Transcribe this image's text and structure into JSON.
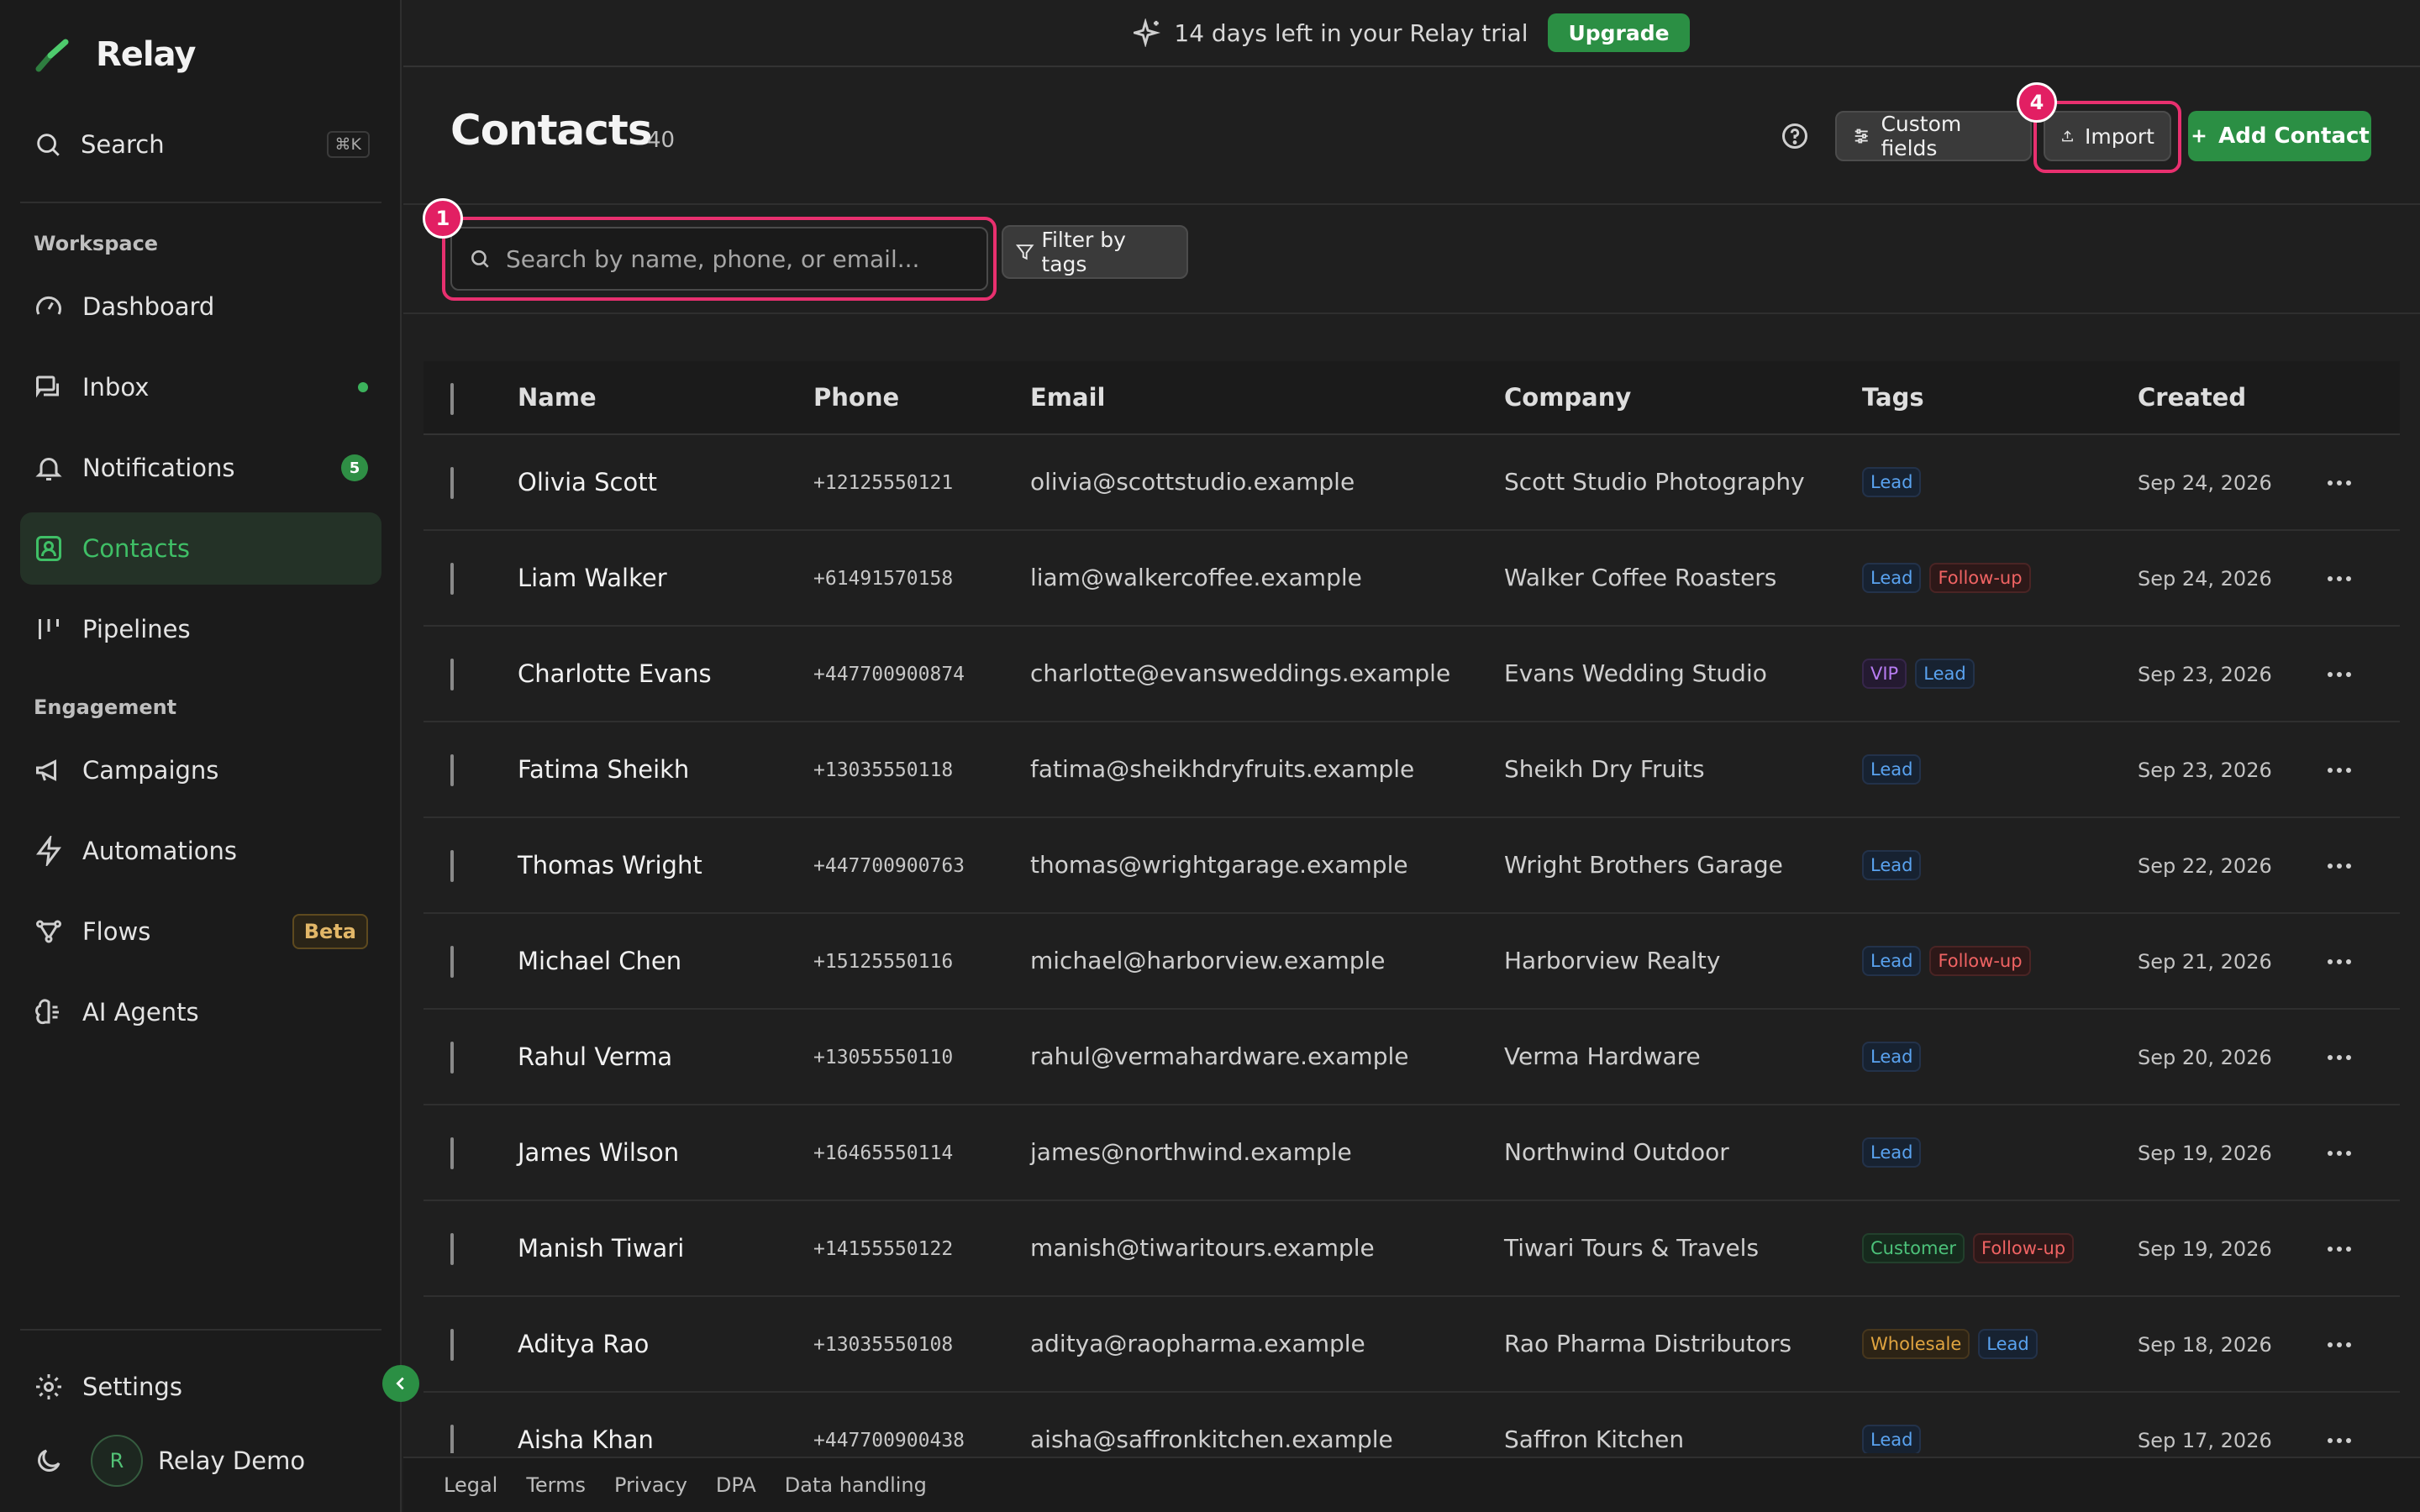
{
  "app": {
    "name": "Relay"
  },
  "sidebar": {
    "search_label": "Search",
    "search_shortcut": "⌘K",
    "sections": {
      "workspace": "Workspace",
      "engagement": "Engagement"
    },
    "items": [
      {
        "label": "Dashboard",
        "icon": "gauge-icon"
      },
      {
        "label": "Inbox",
        "icon": "inbox-icon",
        "dot": true
      },
      {
        "label": "Notifications",
        "icon": "bell-icon",
        "badge": "5"
      },
      {
        "label": "Contacts",
        "icon": "contacts-icon",
        "active": true
      },
      {
        "label": "Pipelines",
        "icon": "pipeline-icon"
      },
      {
        "label": "Campaigns",
        "icon": "megaphone-icon"
      },
      {
        "label": "Automations",
        "icon": "bolt-icon"
      },
      {
        "label": "Flows",
        "icon": "flow-icon",
        "badge": "Beta"
      },
      {
        "label": "AI Agents",
        "icon": "brain-icon"
      }
    ],
    "settings_label": "Settings",
    "user": {
      "initial": "R",
      "name": "Relay Demo"
    }
  },
  "banner": {
    "text": "14 days left in your Relay trial",
    "button": "Upgrade"
  },
  "header": {
    "title": "Contacts",
    "count": "40",
    "custom_fields": "Custom fields",
    "import": "Import",
    "add_contact": "Add Contact",
    "import_marker": "4"
  },
  "search": {
    "placeholder": "Search by name, phone, or email...",
    "value": "",
    "marker": "1",
    "filter_label": "Filter by tags"
  },
  "table": {
    "columns": [
      "Name",
      "Phone",
      "Email",
      "Company",
      "Tags",
      "Created"
    ],
    "rows": [
      {
        "name": "Olivia Scott",
        "phone": "+12125550121",
        "email": "olivia@scottstudio.example",
        "company": "Scott Studio Photography",
        "tags": [
          "Lead"
        ],
        "created": "Sep 24, 2026"
      },
      {
        "name": "Liam Walker",
        "phone": "+61491570158",
        "email": "liam@walkercoffee.example",
        "company": "Walker Coffee Roasters",
        "tags": [
          "Lead",
          "Follow-up"
        ],
        "created": "Sep 24, 2026"
      },
      {
        "name": "Charlotte Evans",
        "phone": "+447700900874",
        "email": "charlotte@evansweddings.example",
        "company": "Evans Wedding Studio",
        "tags": [
          "VIP",
          "Lead"
        ],
        "created": "Sep 23, 2026"
      },
      {
        "name": "Fatima Sheikh",
        "phone": "+13035550118",
        "email": "fatima@sheikhdryfruits.example",
        "company": "Sheikh Dry Fruits",
        "tags": [
          "Lead"
        ],
        "created": "Sep 23, 2026"
      },
      {
        "name": "Thomas Wright",
        "phone": "+447700900763",
        "email": "thomas@wrightgarage.example",
        "company": "Wright Brothers Garage",
        "tags": [
          "Lead"
        ],
        "created": "Sep 22, 2026"
      },
      {
        "name": "Michael Chen",
        "phone": "+15125550116",
        "email": "michael@harborview.example",
        "company": "Harborview Realty",
        "tags": [
          "Lead",
          "Follow-up"
        ],
        "created": "Sep 21, 2026"
      },
      {
        "name": "Rahul Verma",
        "phone": "+13055550110",
        "email": "rahul@vermahardware.example",
        "company": "Verma Hardware",
        "tags": [
          "Lead"
        ],
        "created": "Sep 20, 2026"
      },
      {
        "name": "James Wilson",
        "phone": "+16465550114",
        "email": "james@northwind.example",
        "company": "Northwind Outdoor",
        "tags": [
          "Lead"
        ],
        "created": "Sep 19, 2026"
      },
      {
        "name": "Manish Tiwari",
        "phone": "+14155550122",
        "email": "manish@tiwaritours.example",
        "company": "Tiwari Tours & Travels",
        "tags": [
          "Customer",
          "Follow-up"
        ],
        "created": "Sep 19, 2026"
      },
      {
        "name": "Aditya Rao",
        "phone": "+13035550108",
        "email": "aditya@raopharma.example",
        "company": "Rao Pharma Distributors",
        "tags": [
          "Wholesale",
          "Lead"
        ],
        "created": "Sep 18, 2026"
      },
      {
        "name": "Aisha Khan",
        "phone": "+447700900438",
        "email": "aisha@saffronkitchen.example",
        "company": "Saffron Kitchen",
        "tags": [
          "Lead"
        ],
        "created": "Sep 17, 2026"
      }
    ]
  },
  "footer": {
    "links": [
      "Legal",
      "Terms",
      "Privacy",
      "DPA",
      "Data handling"
    ]
  },
  "colors": {
    "accent": "#2b8f44",
    "highlight": "#e8306f",
    "background": "#1f1f1f"
  }
}
